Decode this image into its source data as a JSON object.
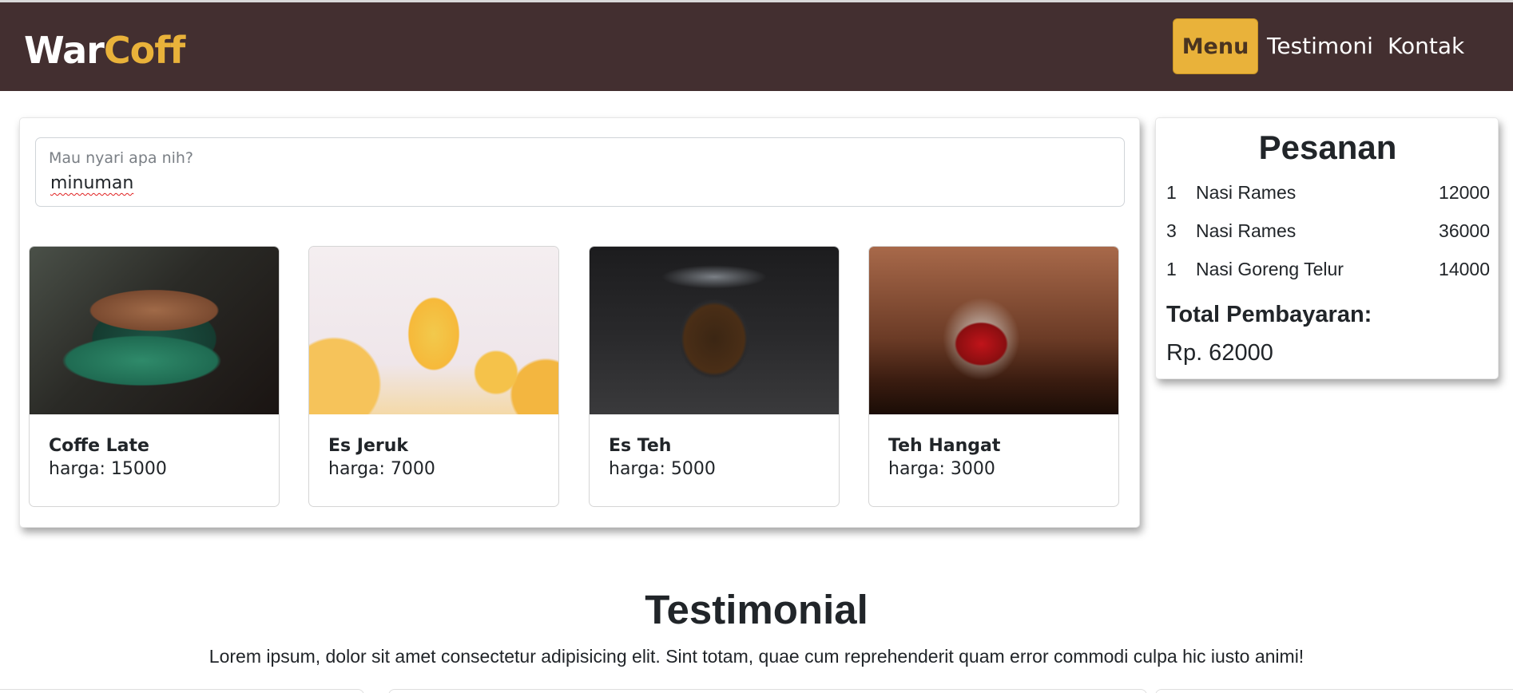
{
  "navbar": {
    "brand_part1": "War",
    "brand_part2": "Coff",
    "brand_color": "#e9b23a",
    "background": "#432f30",
    "items": [
      {
        "label": "Menu",
        "active": true
      },
      {
        "label": "Testimoni",
        "active": false
      },
      {
        "label": "Kontak",
        "active": false
      }
    ]
  },
  "search": {
    "label": "Mau nyari apa nih?",
    "value": "minuman"
  },
  "products": [
    {
      "name": "Coffe Late",
      "price": "harga: 15000",
      "image": "latte-cup-photo"
    },
    {
      "name": "Es Jeruk",
      "price": "harga: 7000",
      "image": "orange-juice-photo"
    },
    {
      "name": "Es Teh",
      "price": "harga: 5000",
      "image": "iced-tea-jar-photo"
    },
    {
      "name": "Teh Hangat",
      "price": "harga: 3000",
      "image": "hot-tea-mug-photo"
    }
  ],
  "order": {
    "title": "Pesanan",
    "items": [
      {
        "qty": "1",
        "name": "Nasi Rames",
        "price": "12000"
      },
      {
        "qty": "3",
        "name": "Nasi Rames",
        "price": "36000"
      },
      {
        "qty": "1",
        "name": "Nasi Goreng Telur",
        "price": "14000"
      }
    ],
    "total_label": "Total Pembayaran:",
    "total_value": "Rp. 62000"
  },
  "testimonial": {
    "title": "Testimonial",
    "text": "Lorem ipsum, dolor sit amet consectetur adipisicing elit. Sint totam, quae cum reprehenderit quam error commodi culpa hic iusto animi!"
  }
}
